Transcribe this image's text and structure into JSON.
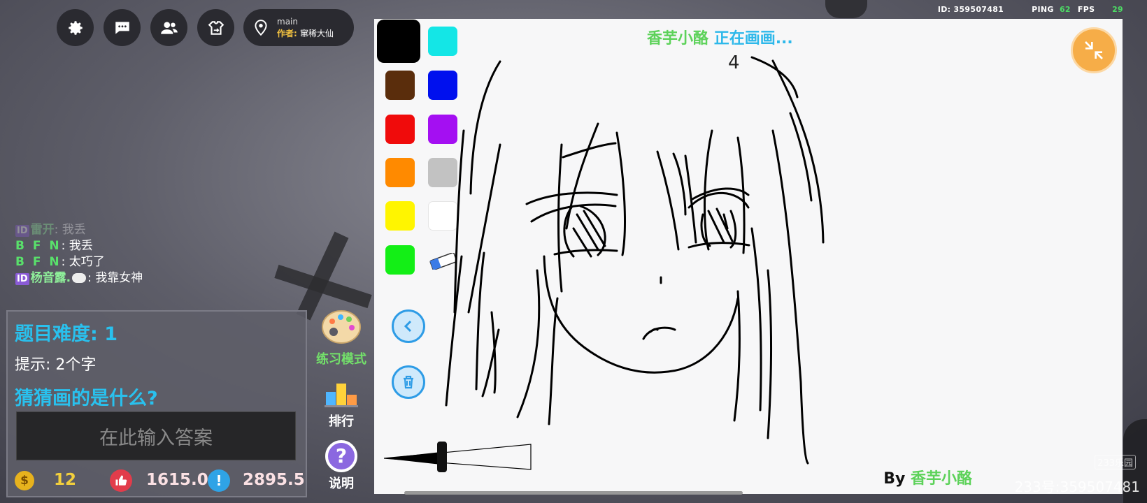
{
  "top": {
    "buttons": [
      {
        "name": "settings-button",
        "icon": "gear-icon"
      },
      {
        "name": "chat-button",
        "icon": "chat-icon"
      },
      {
        "name": "friends-button",
        "icon": "people-icon"
      },
      {
        "name": "outfit-button",
        "icon": "shirt-swap-icon"
      }
    ],
    "map": {
      "name": "main",
      "author_label": "作者:",
      "author": "窜稀大仙"
    },
    "stats": {
      "id_label": "ID:",
      "id": "359507481",
      "ping_label": "PING",
      "ping": "62",
      "fps_label": "FPS",
      "fps": "29"
    }
  },
  "chat": [
    {
      "badge": "ID",
      "name": "雷开",
      "sep": ": ",
      "msg": "我丢",
      "faded": true
    },
    {
      "badge": "",
      "name": "B F N",
      "sep": ": ",
      "msg": "我丢",
      "faded": false
    },
    {
      "badge": "",
      "name": "B F N",
      "sep": ": ",
      "msg": "太巧了",
      "faded": false
    },
    {
      "badge": "ID",
      "name": "杨音露.",
      "sep": ": ",
      "msg": "我靠女神",
      "faded": false
    }
  ],
  "question": {
    "difficulty_label": "题目难度: 1",
    "hint": "提示: 2个字",
    "prompt": "猜猜画的是什么?",
    "answer_placeholder": "在此输入答案",
    "coins": "12",
    "likes": "1615.0",
    "score": "2895.5"
  },
  "side": {
    "practice": "练习模式",
    "rank": "排行",
    "help": "说明"
  },
  "canvas": {
    "drawer": "香芋小酪",
    "status": "正在画画...",
    "timer": "4",
    "by_label": "By",
    "by_name": "香芋小酪",
    "colors": [
      {
        "hex": "#000000",
        "selected": true
      },
      {
        "hex": "#14e6e6",
        "selected": false
      },
      {
        "hex": "#5a2d0c",
        "selected": false
      },
      {
        "hex": "#0010ee",
        "selected": false
      },
      {
        "hex": "#f00b0b",
        "selected": false
      },
      {
        "hex": "#a40ff2",
        "selected": false
      },
      {
        "hex": "#ff8a00",
        "selected": false
      },
      {
        "hex": "#c2c2c2",
        "selected": false
      },
      {
        "hex": "#fff500",
        "selected": false
      },
      {
        "hex": "#ffffff",
        "selected": false
      },
      {
        "hex": "#13ef16",
        "selected": false
      }
    ]
  },
  "watermark": {
    "small": "233乐园",
    "main": "233号:359507481"
  }
}
